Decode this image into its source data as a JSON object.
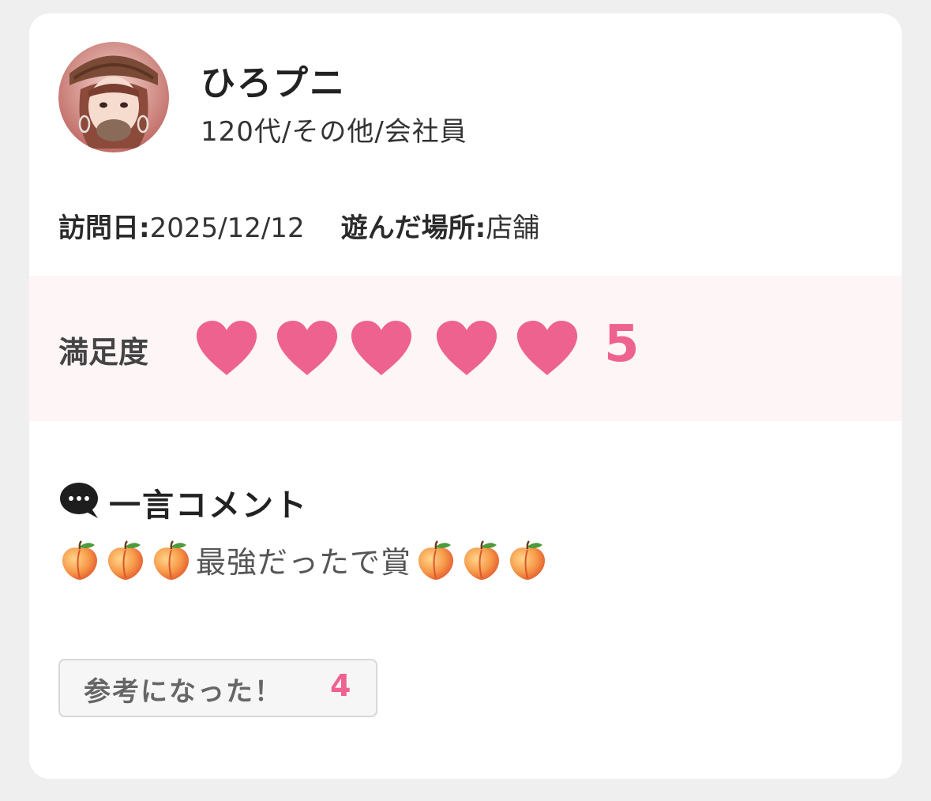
{
  "reviewer": {
    "name": "ひろプニ",
    "profile": "120代/その他/会社員"
  },
  "visit": {
    "date_label": "訪問日:",
    "date_value": "2025/12/12",
    "place_label": "遊んだ場所:",
    "place_value": "店舗"
  },
  "rating": {
    "label": "満足度",
    "value": "5",
    "max": 5,
    "heart_color": "#ee6290"
  },
  "comment": {
    "icon": "speech-bubble-icon",
    "title": "一言コメント",
    "text": "最強だったで賞",
    "emoji": "peach-icon"
  },
  "helpful": {
    "label": "参考になった！",
    "count": "4"
  },
  "colors": {
    "accent": "#ee6290",
    "rating_bg": "#fdf5f6",
    "card_bg": "#ffffff",
    "page_bg": "#efefef"
  }
}
